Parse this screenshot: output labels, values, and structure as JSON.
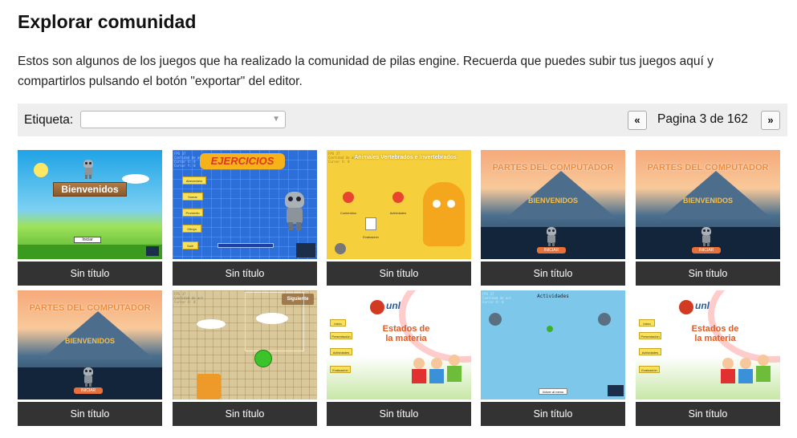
{
  "page": {
    "title": "Explorar comunidad",
    "intro": "Estos son algunos de los juegos que ha realizado la comunidad de pilas engine. Recuerda que puedes subir tus juegos aquí y compartirlos pulsando el botón \"exportar\" del editor."
  },
  "filter": {
    "label": "Etiqueta:",
    "selected": "",
    "arrow_icon": "triangle-down-icon"
  },
  "pagination": {
    "prev_label": "«",
    "next_label": "»",
    "status": "Pagina 3 de 162"
  },
  "games": [
    {
      "caption": "Sin título",
      "thumb_text": "Bienvenidos",
      "button_text": "Iniciar"
    },
    {
      "caption": "Sin título",
      "thumb_text": "EJERCICIOS",
      "menu": [
        "Abecedario",
        "Sumar",
        "Promedio",
        "Dibuja",
        "Salir"
      ]
    },
    {
      "caption": "Sin título",
      "thumb_text": "Animales Vertebrados e Invertebrados",
      "labels": [
        "Contenidos",
        "Actividades",
        "Evaluación"
      ]
    },
    {
      "caption": "Sin título",
      "thumb_text": "PARTES DEL COMPUTADOR",
      "subtitle": "BIENVENIDOS",
      "button_text": "INICIAR"
    },
    {
      "caption": "Sin título",
      "thumb_text": "PARTES DEL COMPUTADOR",
      "subtitle": "BIENVENIDOS",
      "button_text": "INICIAR"
    },
    {
      "caption": "Sin título",
      "thumb_text": "PARTES DEL COMPUTADOR",
      "subtitle": "BIENVENIDOS",
      "button_text": "INICIAR"
    },
    {
      "caption": "Sin título",
      "thumb_text": "Siguiente"
    },
    {
      "caption": "Sin título",
      "thumb_text": "Estados de la materia",
      "logo": "unl",
      "menu": [
        "Inicio",
        "Presentación",
        "Actividades",
        "Evaluación"
      ]
    },
    {
      "caption": "Sin título",
      "thumb_text": "Actividades",
      "button_text": "Volver al menu"
    },
    {
      "caption": "Sin título",
      "thumb_text": "Estados de la materia",
      "logo": "unl",
      "menu": [
        "Inicio",
        "Presentación",
        "Actividades",
        "Evaluación"
      ]
    }
  ],
  "colors": {
    "caption_bg": "#333333",
    "toolbar_bg": "#eeeeee"
  }
}
